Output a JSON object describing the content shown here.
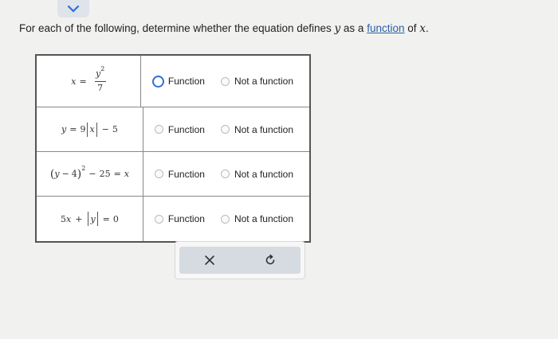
{
  "header": {
    "chevron_icon": "chevron-down-icon"
  },
  "instruction": {
    "before": "For each of the following, determine whether the equation defines",
    "var_y": "y",
    "as_a": "as a",
    "link": "function",
    "of": "of",
    "var_x": "x",
    "end": "."
  },
  "rows": [
    {
      "equation": {
        "lhs": "x",
        "eq": "=",
        "num": "y",
        "num_exp": "2",
        "den": "7"
      },
      "options": [
        "Function",
        "Not a function"
      ]
    },
    {
      "equation": {
        "y": "y",
        "eq": "=",
        "coef": "9",
        "var": "x",
        "minus": "−",
        "const": "5"
      },
      "options": [
        "Function",
        "Not a function"
      ]
    },
    {
      "equation": {
        "open": "(",
        "y": "y",
        "minus": "−",
        "four": "4",
        "close": ")",
        "exp": "2",
        "minus2": "−",
        "twentyfive": "25",
        "eq": "=",
        "x": "x"
      },
      "options": [
        "Function",
        "Not a function"
      ]
    },
    {
      "equation": {
        "five": "5",
        "x": "x",
        "plus": "+",
        "y": "y",
        "eq": "=",
        "zero": "0"
      },
      "options": [
        "Function",
        "Not a function"
      ]
    }
  ],
  "actions": {
    "clear_icon": "close-icon",
    "reset_icon": "undo-icon"
  },
  "colors": {
    "focus_ring": "#2f6fd6",
    "link": "#2a5fa8",
    "action_bg": "#d6dbe2"
  }
}
